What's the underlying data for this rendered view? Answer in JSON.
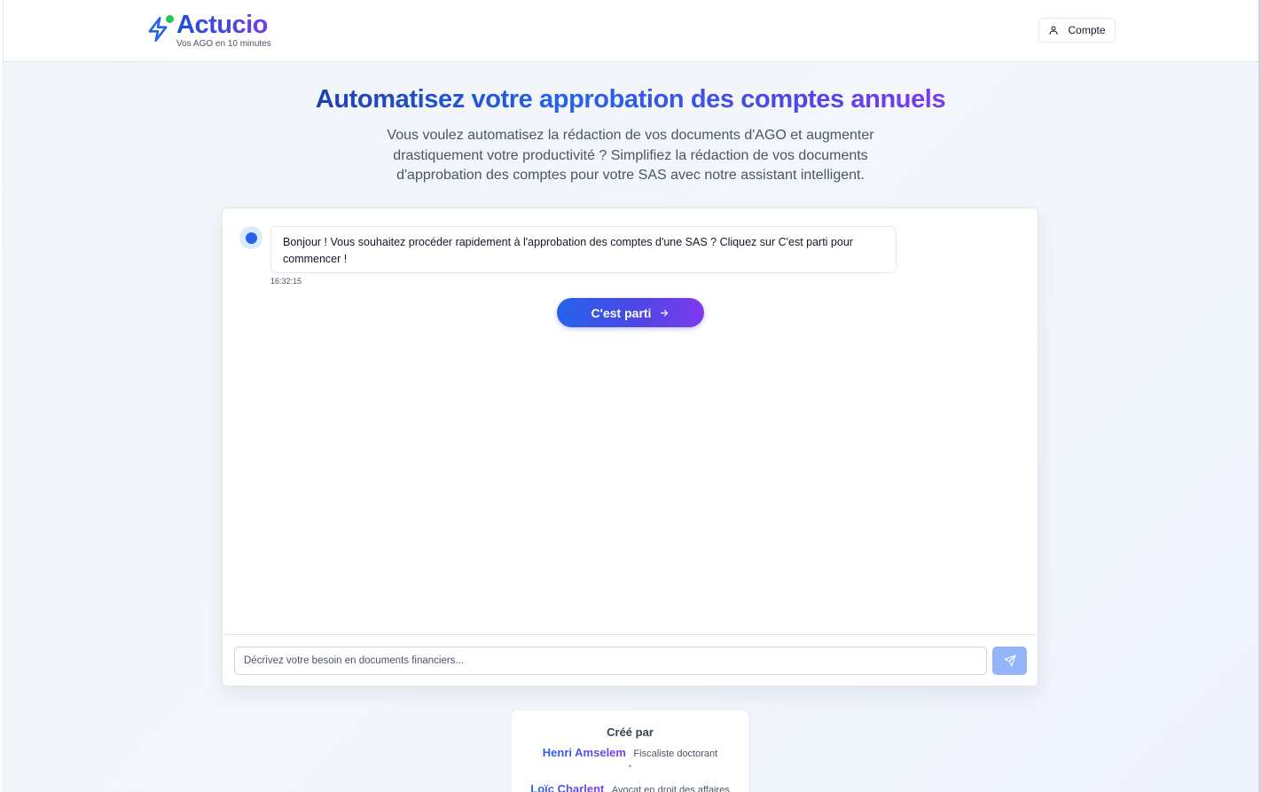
{
  "header": {
    "brand": "Actucio",
    "tagline": "Vos AGO en 10 minutes",
    "account_label": "Compte"
  },
  "hero": {
    "title": "Automatisez votre approbation des comptes annuels",
    "subtitle": "Vous voulez automatisez la rédaction de vos documents d'AGO et augmenter drastiquement votre productivité ? Simplifiez la rédaction de vos documents d'approbation des comptes pour votre SAS avec notre assistant intelligent."
  },
  "chat": {
    "messages": [
      {
        "text": "Bonjour ! Vous souhaitez procéder rapidement à l'approbation des comptes d'une SAS ? Cliquez sur C'est parti pour commencer !",
        "time": "16:32:15"
      }
    ],
    "start_button_label": "C'est parti",
    "input_placeholder": "Décrivez votre besoin en documents financiers...",
    "input_value": ""
  },
  "credits": {
    "title": "Créé par",
    "separator": "•",
    "people": [
      {
        "name": "Henri Amselem",
        "role": "Fiscaliste doctorant"
      },
      {
        "name": "Loïc Charlent",
        "role": "Avocat en droit des affaires"
      }
    ]
  },
  "icons": {
    "logo": "lightning-bolt-icon",
    "account": "user-icon",
    "start": "arrow-right-icon",
    "send": "send-icon"
  },
  "colors": {
    "primary": "#2563eb",
    "accent": "#7c3aed",
    "status_dot": "#22c55e",
    "send_disabled": "#93b4f8"
  }
}
